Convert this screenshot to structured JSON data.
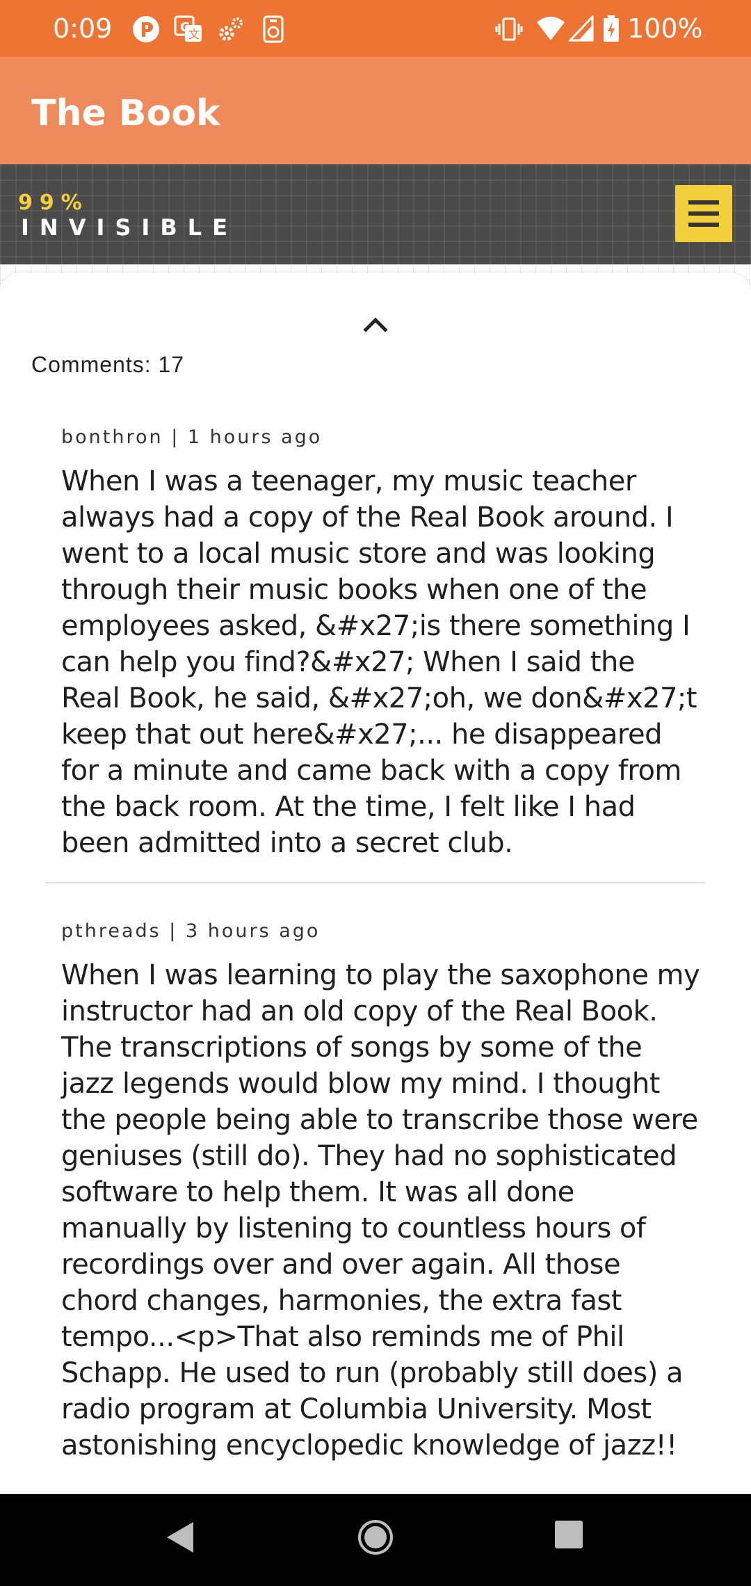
{
  "status_bar": {
    "time": "0:09",
    "battery": "100%",
    "icons": [
      "p-circle-icon",
      "translate-icon",
      "settings-gear-icon",
      "voice-record-icon",
      "vibrate-icon",
      "wifi-icon",
      "signal-icon",
      "battery-icon"
    ]
  },
  "app_bar": {
    "title": "The Book"
  },
  "site_header": {
    "logo_top": "99%",
    "logo_bottom": "INVISIBLE",
    "accent_color": "#f3cf3c",
    "menu_icon": "hamburger-menu-icon"
  },
  "comments": {
    "count_label": "Comments: 17",
    "items": [
      {
        "meta": "bonthron | 1 hours ago",
        "body": "When I was a teenager, my music teacher always had a copy of the Real Book around. I went to a local music store and was looking through their music books when one of the employees asked, &#x27;is there something I can help you find?&#x27; When I said the Real Book, he said, &#x27;oh, we don&#x27;t keep that out here&#x27;... he disappeared for a minute and came back with a copy from the back room. At the time, I felt like I had been admitted into a secret club."
      },
      {
        "meta": "pthreads | 3 hours ago",
        "body": "When I was learning to play the saxophone my instructor had an old copy of the Real Book. The transcriptions of songs by some of the jazz legends  would blow my mind. I thought the people being able to transcribe those were geniuses (still do). They had no sophisticated software to help them. It was all done manually by listening to countless hours of recordings over and over again. All those chord changes, harmonies, the extra fast tempo...<p>That also reminds me of Phil Schapp. He used to run (probably still does) a radio program at Columbia University. Most astonishing encyclopedic knowledge of jazz!!"
      }
    ]
  },
  "colors": {
    "status_bar": "#ee7433",
    "app_bar": "#ef8b5a",
    "header_bg": "#4a4a4a"
  }
}
